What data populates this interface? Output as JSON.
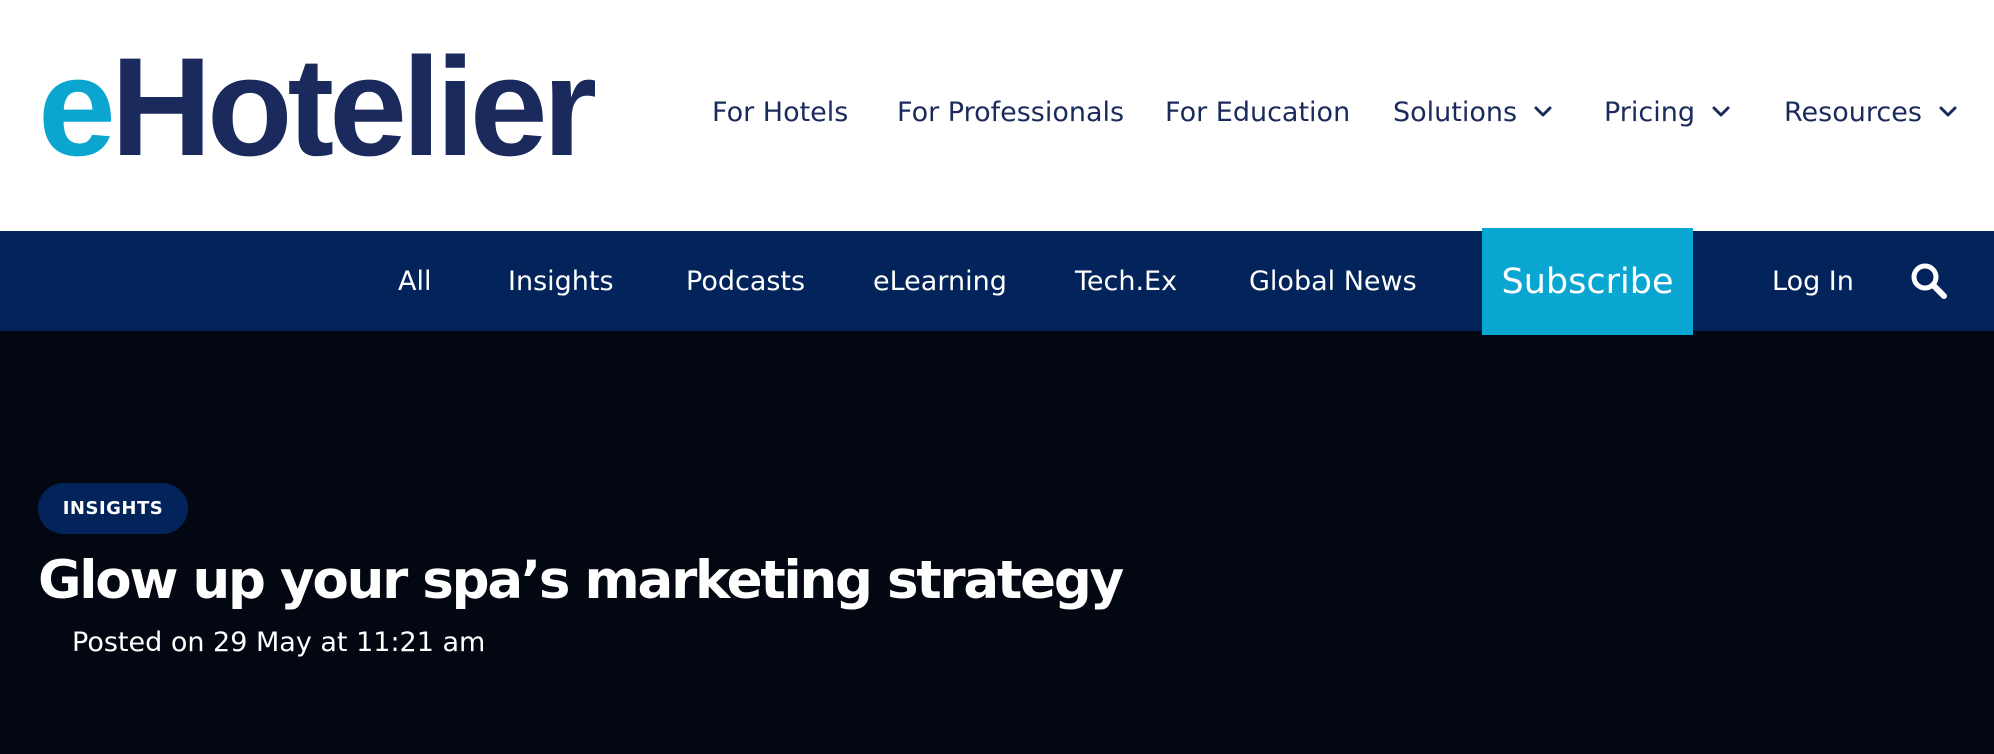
{
  "logo": {
    "prefix": "e",
    "rest": "Hotelier"
  },
  "main_nav": [
    {
      "label": "For Hotels",
      "has_dropdown": false
    },
    {
      "label": "For Professionals",
      "has_dropdown": false
    },
    {
      "label": "For Education",
      "has_dropdown": false
    },
    {
      "label": "Solutions",
      "has_dropdown": true
    },
    {
      "label": "Pricing",
      "has_dropdown": true
    },
    {
      "label": "Resources",
      "has_dropdown": true
    }
  ],
  "sub_nav": [
    {
      "label": "All"
    },
    {
      "label": "Insights"
    },
    {
      "label": "Podcasts"
    },
    {
      "label": "eLearning"
    },
    {
      "label": "Tech.Ex"
    },
    {
      "label": "Global News"
    }
  ],
  "actions": {
    "subscribe_label": "Subscribe",
    "login_label": "Log In",
    "search_icon": "search-icon"
  },
  "article": {
    "category": "INSIGHTS",
    "title": "Glow up your spa’s marketing strategy",
    "posted": "Posted on 29 May at 11:21 am"
  },
  "colors": {
    "brand_navy": "#1b2a5c",
    "brand_cyan": "#0ba6d0",
    "bar_navy": "#02245a",
    "hero_bg": "#030711",
    "subscribe_bg": "#08a6d1"
  }
}
